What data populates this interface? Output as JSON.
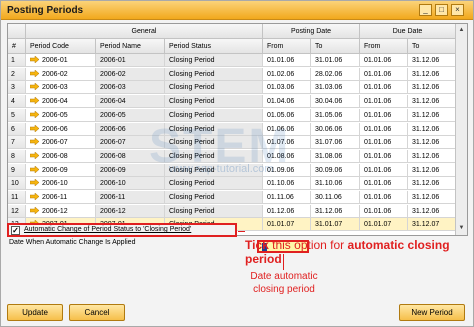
{
  "window": {
    "title": "Posting Periods"
  },
  "titlebar_buttons": [
    "_",
    "□",
    "×"
  ],
  "grid": {
    "group_headers": [
      "General",
      "Posting Date",
      "Due Date"
    ],
    "column_headers": [
      "#",
      "Period Code",
      "Period Name",
      "Period Status",
      "From",
      "To",
      "From",
      "To"
    ],
    "rows": [
      [
        "1",
        "2006-01",
        "2006-01",
        "Closing Period",
        "01.01.06",
        "31.01.06",
        "01.01.06",
        "31.12.06"
      ],
      [
        "2",
        "2006-02",
        "2006-02",
        "Closing Period",
        "01.02.06",
        "28.02.06",
        "01.01.06",
        "31.12.06"
      ],
      [
        "3",
        "2006-03",
        "2006-03",
        "Closing Period",
        "01.03.06",
        "31.03.06",
        "01.01.06",
        "31.12.06"
      ],
      [
        "4",
        "2006-04",
        "2006-04",
        "Closing Period",
        "01.04.06",
        "30.04.06",
        "01.01.06",
        "31.12.06"
      ],
      [
        "5",
        "2006-05",
        "2006-05",
        "Closing Period",
        "01.05.06",
        "31.05.06",
        "01.01.06",
        "31.12.06"
      ],
      [
        "6",
        "2006-06",
        "2006-06",
        "Closing Period",
        "01.06.06",
        "30.06.06",
        "01.01.06",
        "31.12.06"
      ],
      [
        "7",
        "2006-07",
        "2006-07",
        "Closing Period",
        "01.07.06",
        "31.07.06",
        "01.01.06",
        "31.12.06"
      ],
      [
        "8",
        "2006-08",
        "2006-08",
        "Closing Period",
        "01.08.06",
        "31.08.06",
        "01.01.06",
        "31.12.06"
      ],
      [
        "9",
        "2006-09",
        "2006-09",
        "Closing Period",
        "01.09.06",
        "30.09.06",
        "01.01.06",
        "31.12.06"
      ],
      [
        "10",
        "2006-10",
        "2006-10",
        "Closing Period",
        "01.10.06",
        "31.10.06",
        "01.01.06",
        "31.12.06"
      ],
      [
        "11",
        "2006-11",
        "2006-11",
        "Closing Period",
        "01.11.06",
        "30.11.06",
        "01.01.06",
        "31.12.06"
      ],
      [
        "12",
        "2006-12",
        "2006-12",
        "Closing Period",
        "01.12.06",
        "31.12.06",
        "01.01.06",
        "31.12.06"
      ],
      [
        "13",
        "2007-01",
        "2007-01",
        "Closing Period",
        "01.01.07",
        "31.01.07",
        "01.01.07",
        "31.12.07"
      ]
    ],
    "highlighted_row": 12
  },
  "auto_change": {
    "checkbox_label": "Automatic Change of Period Status to 'Closing Period'",
    "checked": true,
    "date_label": "Date When Automatic Change Is Applied",
    "date_value": ""
  },
  "annotations": {
    "tick_prefix": "Tick",
    "tick_middle": " this option for ",
    "tick_bold": "automatic closing",
    "tick_line2": "period",
    "date_note_l1": "Date automatic",
    "date_note_l2": "closing period"
  },
  "watermark": {
    "text": "STEM",
    "sub": "www.sap-tutorial.com"
  },
  "buttons": {
    "update": "Update",
    "cancel": "Cancel",
    "new_period": "New Period"
  },
  "colors": {
    "titlebar": "#f2a81c",
    "annotation_red": "#e02020",
    "date_field_bg": "#fff7a8"
  },
  "icons": {
    "row_link": "link-arrow-icon"
  }
}
